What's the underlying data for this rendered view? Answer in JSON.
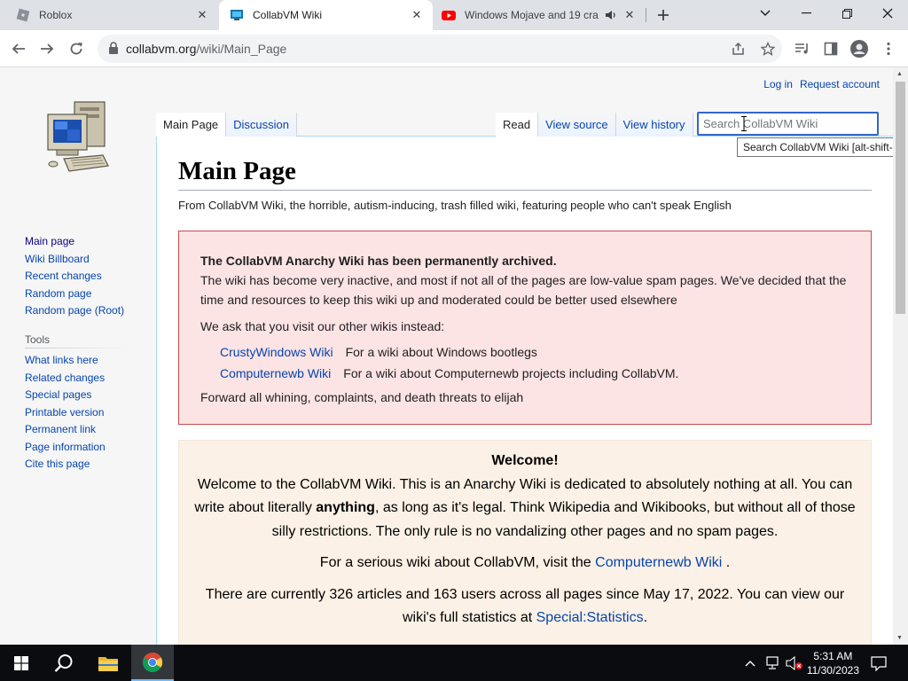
{
  "browser": {
    "tabs": [
      {
        "title": "Roblox",
        "icon": "roblox-icon",
        "active": false
      },
      {
        "title": "CollabVM Wiki",
        "icon": "collabvm-icon",
        "active": true
      },
      {
        "title": "Windows Mojave and 19 cra",
        "icon": "youtube-icon",
        "active": false,
        "audio": true
      }
    ],
    "url_host": "collabvm.org",
    "url_path": "/wiki/Main_Page"
  },
  "wiki": {
    "personal": {
      "login": "Log in",
      "request": "Request account"
    },
    "left_tabs": [
      "Main Page",
      "Discussion"
    ],
    "right_tabs": [
      "Read",
      "View source",
      "View history"
    ],
    "search_placeholder": "Search CollabVM Wiki",
    "search_tooltip": "Search CollabVM Wiki [alt-shift-f]",
    "nav": [
      "Main page",
      "Wiki Billboard",
      "Recent changes",
      "Random page",
      "Random page (Root)"
    ],
    "tools_heading": "Tools",
    "tools": [
      "What links here",
      "Related changes",
      "Special pages",
      "Printable version",
      "Permanent link",
      "Page information",
      "Cite this page"
    ],
    "heading": "Main Page",
    "tagline": "From CollabVM Wiki, the horrible, autism-inducing, trash filled wiki, featuring people who can't speak English",
    "archive": {
      "title": "The CollabVM Anarchy Wiki has been permanently archived.",
      "body": "The wiki has become very inactive, and most if not all of the pages are low-value spam pages. We've decided that the time and resources to keep this wiki up and moderated could be better used elsewhere",
      "ask": "We ask that you visit our other wikis instead:",
      "wikis": [
        {
          "name": "CrustyWindows Wiki",
          "desc": "For a wiki about Windows bootlegs"
        },
        {
          "name": "Computernewb Wiki",
          "desc": "For a wiki about Computernewb projects including CollabVM."
        }
      ],
      "footer": "Forward all whining, complaints, and death threats to elijah"
    },
    "welcome": {
      "title": "Welcome!",
      "p1_a": "Welcome to the CollabVM Wiki. This is an Anarchy Wiki is dedicated to absolutely nothing at all. You can write about literally ",
      "p1_bold": "anything",
      "p1_b": ", as long as it's legal. Think Wikipedia and Wikibooks, but without all of those silly restrictions. The only rule is no vandalizing other pages and no spam pages.",
      "p2_a": "For a serious wiki about CollabVM, visit the ",
      "p2_link": "Computernewb Wiki",
      "p2_b": " .",
      "p3_a": "There are currently 326 articles and 163 users across all pages since May 17, 2022. You can view our wiki's full statistics at ",
      "p3_link": "Special:Statistics",
      "p3_b": "."
    }
  },
  "taskbar": {
    "time": "5:31 AM",
    "date": "11/30/2023"
  }
}
